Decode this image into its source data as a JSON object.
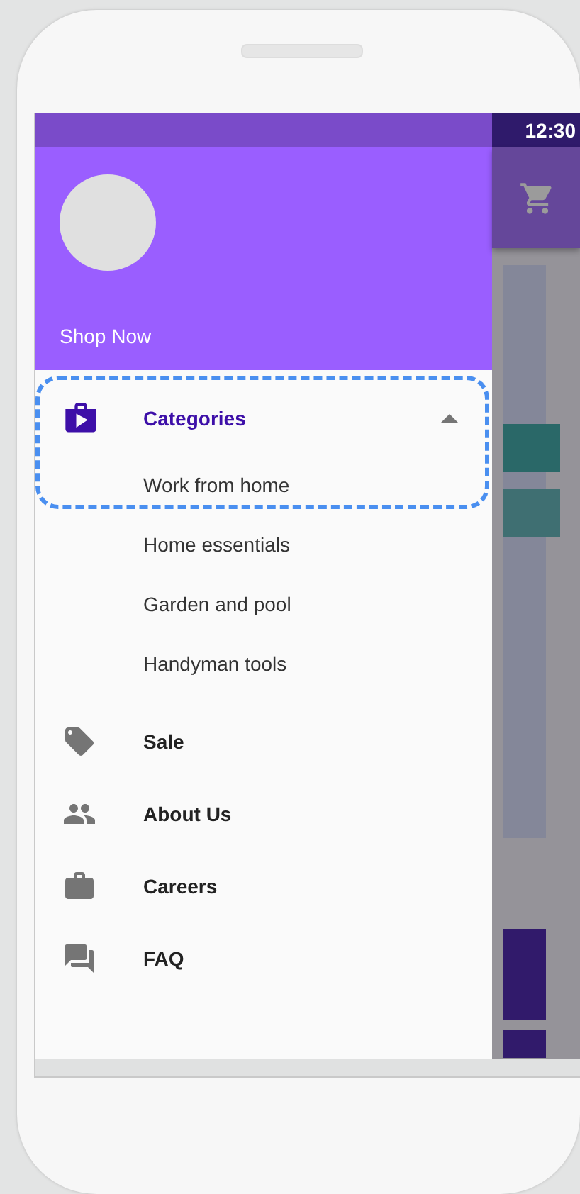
{
  "status_bar": {
    "time": "12:30"
  },
  "drawer": {
    "header": {
      "label": "Shop Now"
    },
    "menu": [
      {
        "label": "Categories",
        "kind": "group",
        "expanded": true,
        "selected": true,
        "highlighted": true,
        "children": [
          {
            "label": "Work from home",
            "highlighted": true
          },
          {
            "label": "Home essentials",
            "highlighted": false
          },
          {
            "label": "Garden and pool",
            "highlighted": false
          },
          {
            "label": "Handyman tools",
            "highlighted": false
          }
        ]
      },
      {
        "label": "Sale",
        "kind": "link",
        "selected": false
      },
      {
        "label": "About Us",
        "kind": "link",
        "selected": false
      },
      {
        "label": "Careers",
        "kind": "link",
        "selected": false
      },
      {
        "label": "FAQ",
        "kind": "link",
        "selected": false
      }
    ]
  }
}
